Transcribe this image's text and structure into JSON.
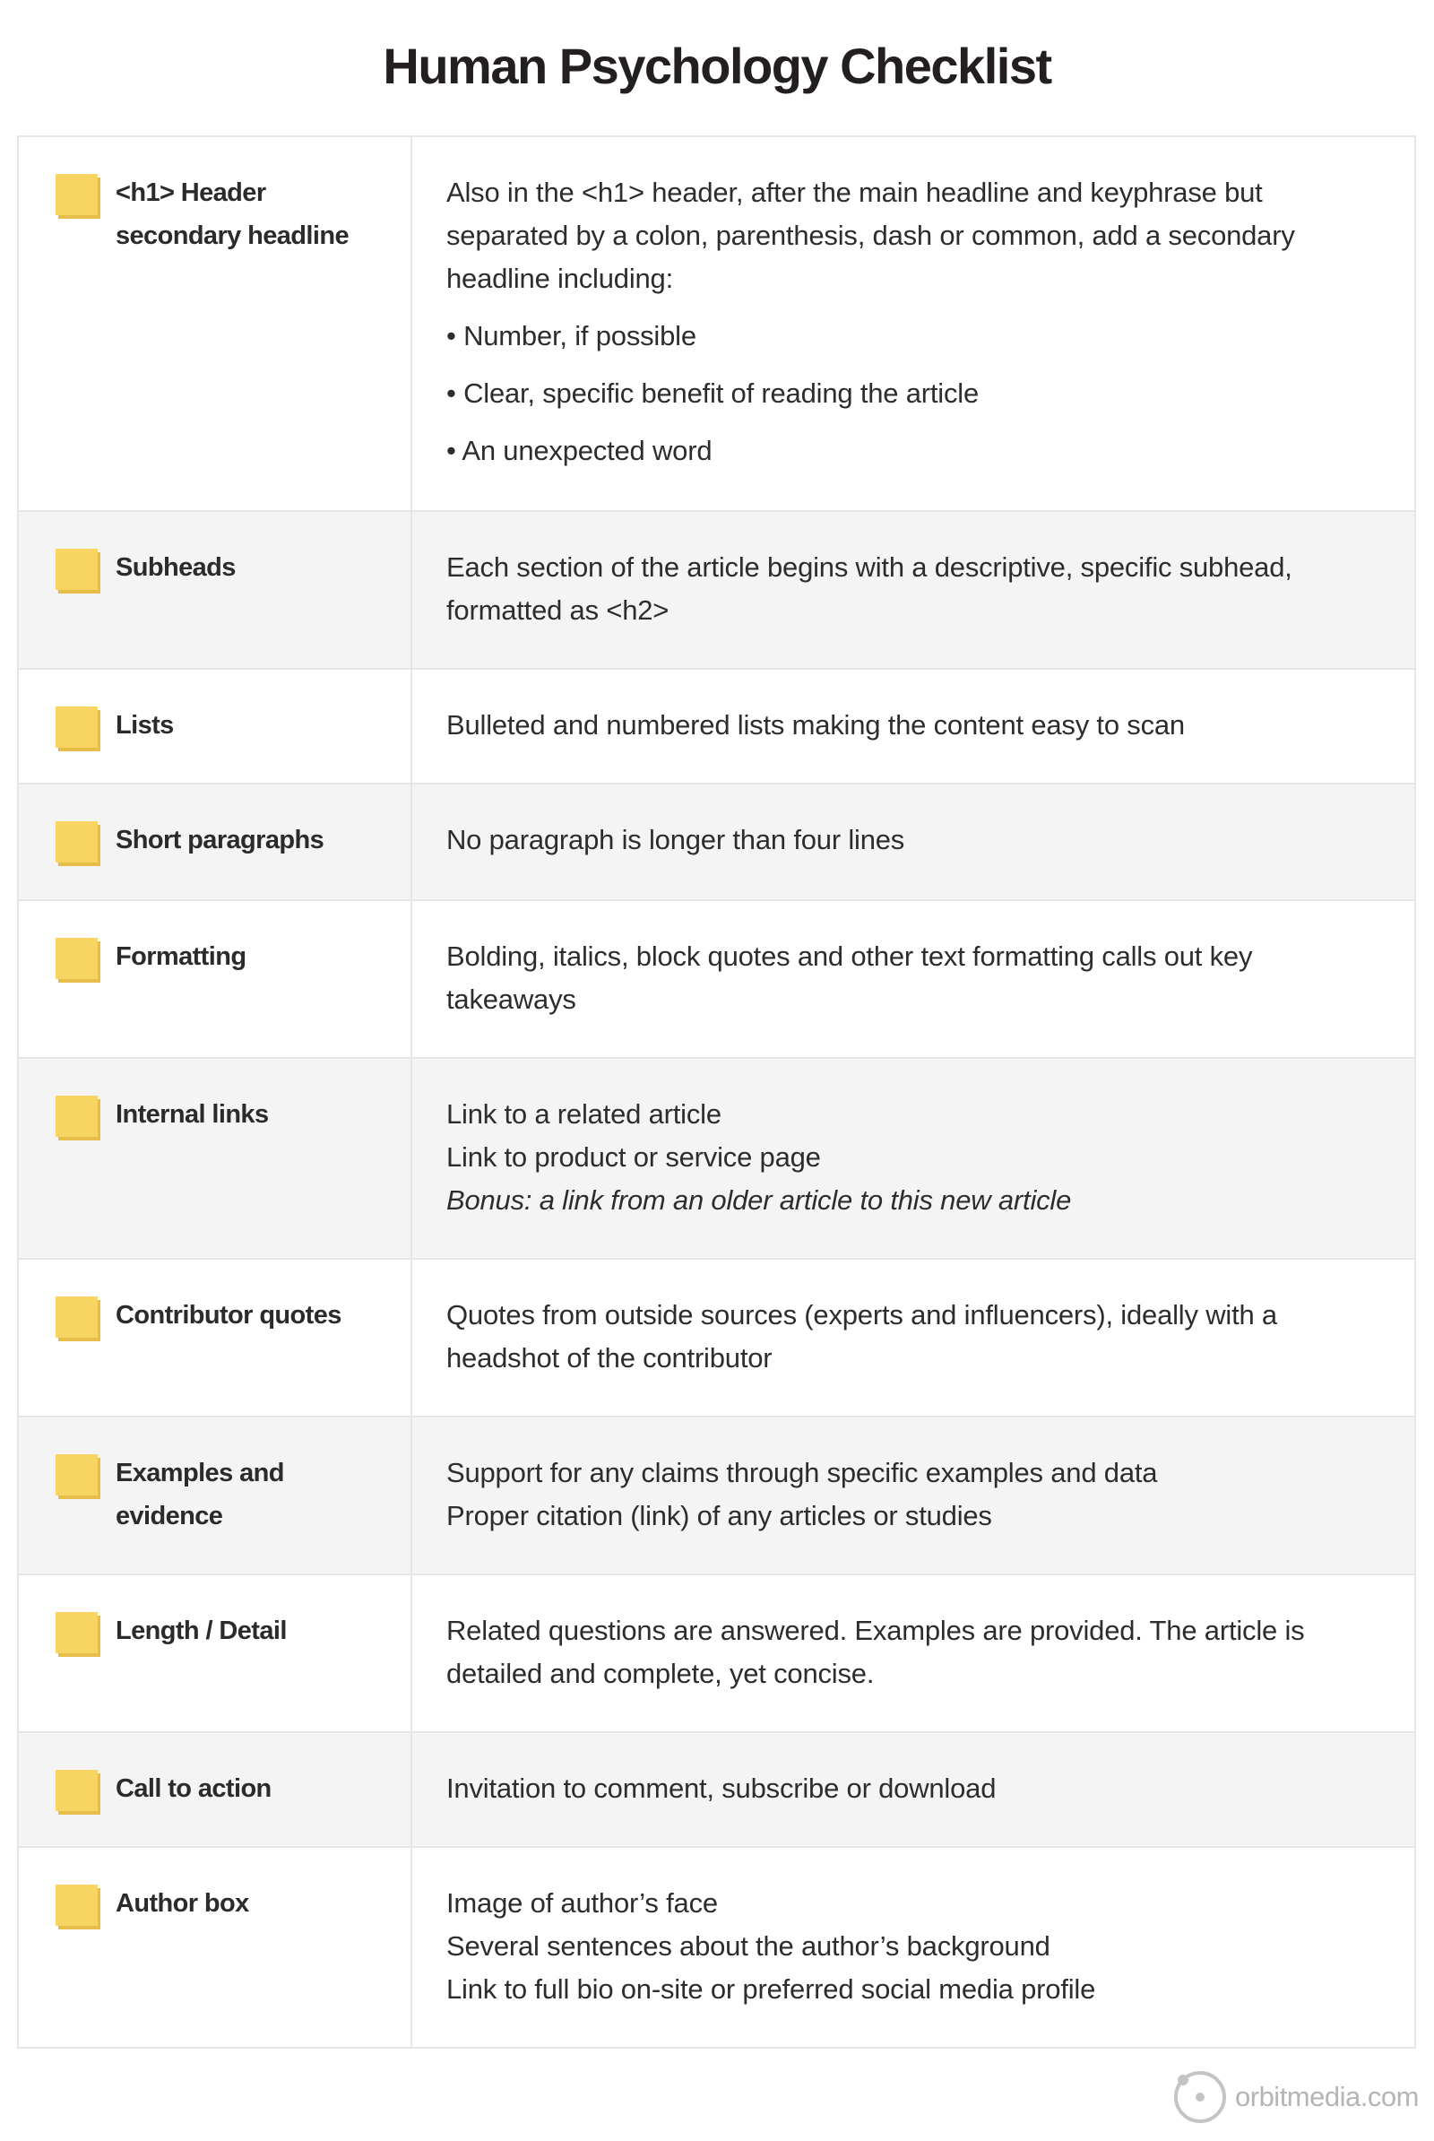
{
  "title": "Human Psychology Checklist",
  "checklist": [
    {
      "label": "<h1> Header secondary headline",
      "label_lines": [
        "<h1> Header",
        "secondary headline"
      ],
      "description": [
        {
          "text": "Also in the <h1> header, after the main headline and keyphrase but separated by a colon, parenthesis, dash or common, add a secondary headline including:",
          "style": "normal"
        },
        {
          "text": "• Number, if possible",
          "style": "bullet"
        },
        {
          "text": "• Clear, specific benefit of reading the article",
          "style": "bullet"
        },
        {
          "text": "• An unexpected word",
          "style": "bullet"
        }
      ]
    },
    {
      "label": "Subheads",
      "description": [
        {
          "text": "Each section of the article begins with a descriptive, specific subhead, formatted as <h2>",
          "style": "normal"
        }
      ]
    },
    {
      "label": "Lists",
      "description": [
        {
          "text": "Bulleted and numbered lists making the content easy to scan",
          "style": "normal"
        }
      ]
    },
    {
      "label": "Short paragraphs",
      "description": [
        {
          "text": "No paragraph is longer than four lines",
          "style": "normal"
        }
      ]
    },
    {
      "label": "Formatting",
      "description": [
        {
          "text": "Bolding, italics, block quotes and other text formatting calls out key takeaways",
          "style": "normal"
        }
      ]
    },
    {
      "label": "Internal links",
      "description": [
        {
          "text": "Link to a related article",
          "style": "normal"
        },
        {
          "text": "Link to product or service page",
          "style": "normal"
        },
        {
          "text": "Bonus: a link from an older article to this new article",
          "style": "italic"
        }
      ]
    },
    {
      "label": "Contributor quotes",
      "description": [
        {
          "text": "Quotes from outside sources (experts and influencers), ideally with a headshot of the contributor",
          "style": "normal"
        }
      ]
    },
    {
      "label": "Examples and evidence",
      "label_lines": [
        "Examples and",
        "evidence"
      ],
      "description": [
        {
          "text": "Support for any claims through specific examples and data",
          "style": "normal"
        },
        {
          "text": "Proper citation (link) of any articles or studies",
          "style": "normal"
        }
      ]
    },
    {
      "label": "Length / Detail",
      "description": [
        {
          "text": "Related questions are answered. Examples are provided. The article is detailed and complete, yet concise.",
          "style": "normal"
        }
      ]
    },
    {
      "label": "Call to action",
      "description": [
        {
          "text": "Invitation to comment, subscribe or download",
          "style": "normal"
        }
      ]
    },
    {
      "label": "Author box",
      "description": [
        {
          "text": "Image of author’s face",
          "style": "normal"
        },
        {
          "text": "Several sentences about the author’s background",
          "style": "normal"
        },
        {
          "text": "Link to full bio on-site or preferred social media profile",
          "style": "normal"
        }
      ]
    }
  ],
  "checkbox_icon": "sticky-note-icon",
  "colors": {
    "note_front": "#f8d462",
    "note_shadow": "#e7bd4a",
    "alt_row_bg": "#f4f4f4",
    "border": "#e6e6e6",
    "text": "#2d2d2d",
    "logo": "#b5b5b5"
  },
  "footer": {
    "logo_icon": "orbit-icon",
    "logo_text": "orbitmedia.com"
  }
}
